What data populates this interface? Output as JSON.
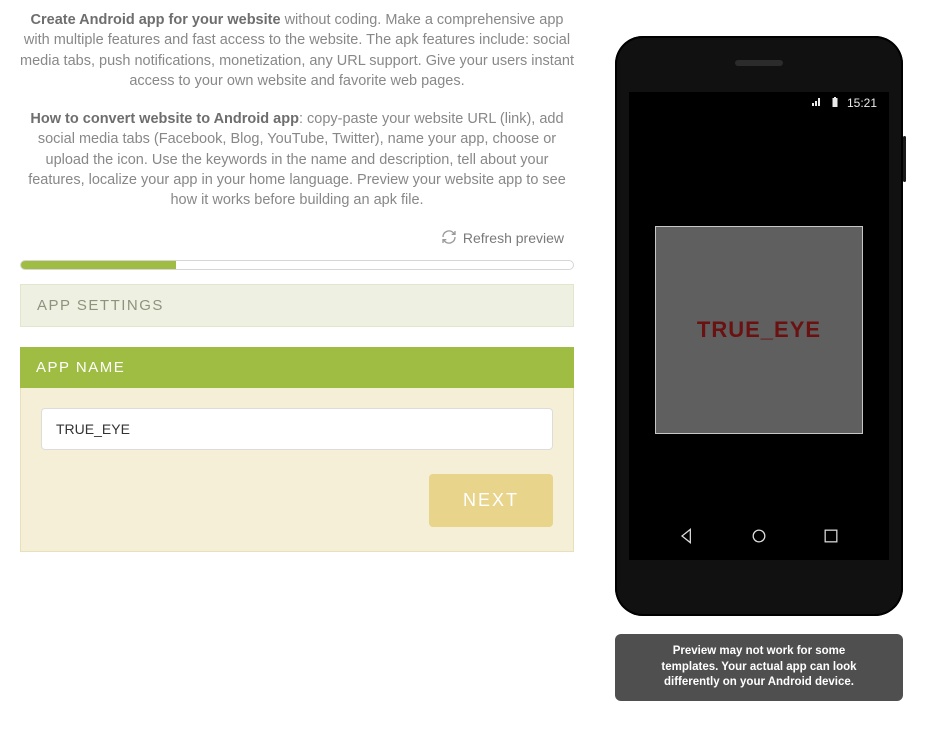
{
  "intro": {
    "p1_bold": "Create Android app for your website",
    "p1_rest": " without coding. Make a comprehensive app with multiple features and fast access to the website. The apk features include: social media tabs, push notifications, monetization, any URL support. Give your users instant access to your own website and favorite web pages.",
    "p2_bold": "How to convert website to Android app",
    "p2_rest": ": copy-paste your website URL (link), add social media tabs (Facebook, Blog, YouTube, Twitter), name your app, choose or upload the icon. Use the keywords in the name and description, tell about your features, localize your app in your home language. Preview your website app to see how it works before building an apk file."
  },
  "refresh_label": "Refresh preview",
  "progress_percent": 28,
  "panels": {
    "settings_label": "APP SETTINGS",
    "name_label": "APP NAME"
  },
  "form": {
    "app_name_value": "TRUE_EYE",
    "next_label": "NEXT"
  },
  "preview": {
    "status_time": "15:21",
    "splash_text": "TRUE_EYE"
  },
  "notice_line1": "Preview may not work for some",
  "notice_line2": "templates. Your actual app can look",
  "notice_line3": "differently on your Android device."
}
